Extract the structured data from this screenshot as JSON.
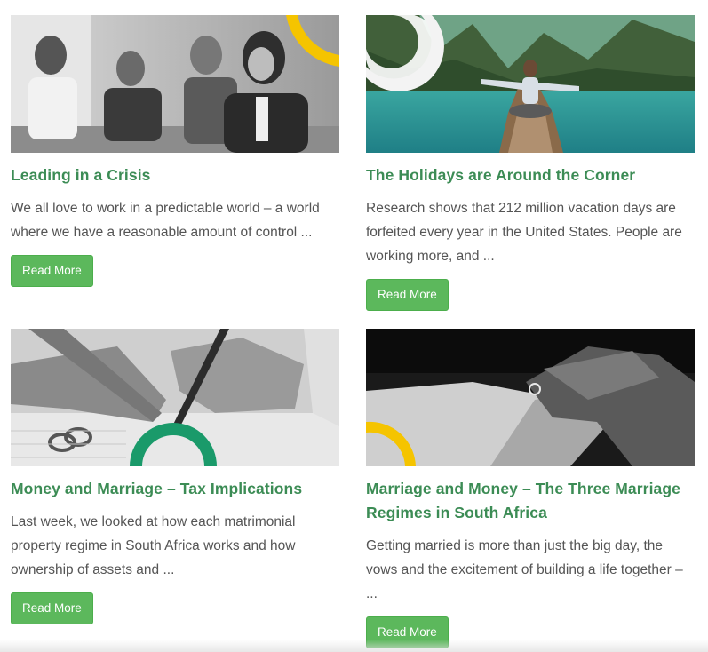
{
  "colors": {
    "title": "#3c8c55",
    "button_bg": "#5cb85c",
    "accent_yellow": "#f5c400",
    "accent_green": "#1a9a6a",
    "text": "#555555"
  },
  "posts": [
    {
      "image": "business-meeting-photo",
      "title": "Leading in a Crisis",
      "excerpt": "We all love to work in a predictable world – a world where we have a reasonable amount of control ...",
      "button": "Read More"
    },
    {
      "image": "woman-on-boat-lake-photo",
      "title": "The Holidays are Around the Corner",
      "excerpt": "Research shows that 212 million vacation days are forfeited every year in the United States. People are working more, and ...",
      "button": "Read More"
    },
    {
      "image": "signing-document-rings-photo",
      "title": "Money and Marriage – Tax Implications",
      "excerpt": "Last week, we looked at how each matrimonial property regime in South Africa works and how ownership of assets and ...",
      "button": "Read More"
    },
    {
      "image": "wedding-ring-hands-photo",
      "title": "Marriage and Money – The Three Marriage Regimes in South Africa",
      "excerpt": "Getting married is more than just the big day, the vows and the excitement of building a life together – ...",
      "button": "Read More"
    }
  ]
}
